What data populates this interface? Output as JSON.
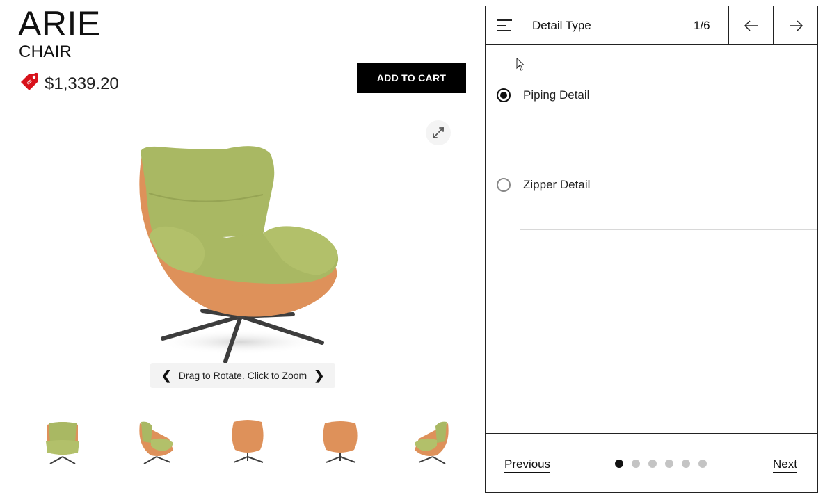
{
  "product": {
    "name": "ARIE",
    "type": "CHAIR",
    "price": "$1,339.20",
    "add_to_cart_label": "ADD TO CART",
    "price_tag_icon": "price-tag-icon",
    "tag_color": "#d8121b"
  },
  "viewer": {
    "hint": "Drag to Rotate. Click to Zoom",
    "expand_icon": "expand-icon",
    "chair_colors": {
      "fabric": "#a9b863",
      "shell": "#de915a",
      "base": "#3d3d3d"
    }
  },
  "thumbnails": [
    "front",
    "left-side",
    "back-left",
    "back-right",
    "right-side"
  ],
  "panel": {
    "title": "Detail Type",
    "step": "1/6",
    "options": [
      {
        "label": "Piping Detail",
        "selected": true
      },
      {
        "label": "Zipper Detail",
        "selected": false
      }
    ],
    "footer": {
      "previous_label": "Previous",
      "next_label": "Next",
      "step_dots": 6,
      "active_dot": 1
    }
  }
}
